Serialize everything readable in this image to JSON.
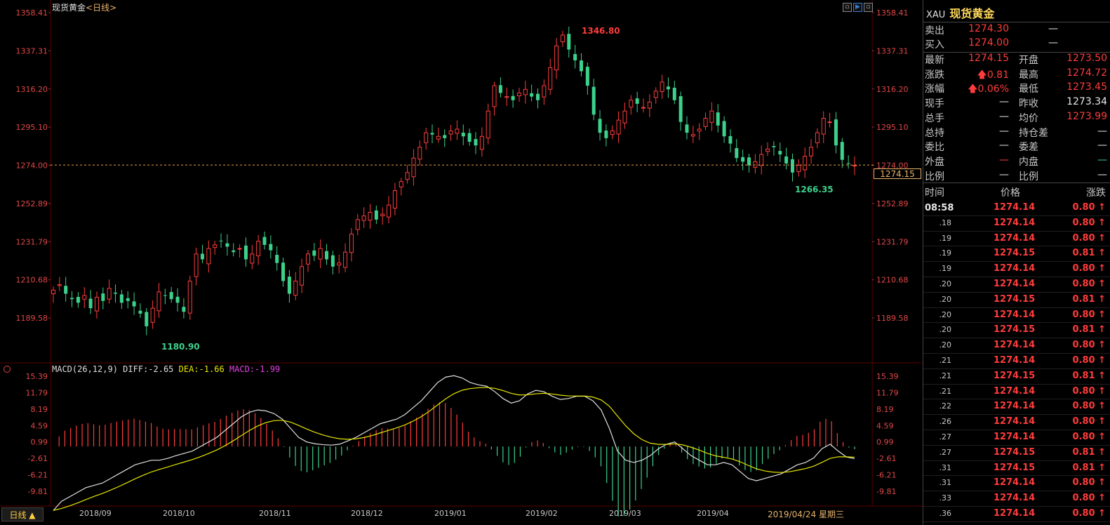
{
  "chart": {
    "title": "现货黄金",
    "period": "<日线>",
    "price_axis_ticks": [
      "1358.41",
      "1337.31",
      "1316.20",
      "1295.10",
      "1274.00",
      "1252.89",
      "1231.79",
      "1210.68",
      "1189.58"
    ],
    "price_range": [
      1180.0,
      1360.0
    ],
    "current_price_tag": "1274.15",
    "high_marker": "1346.80",
    "low_marker_recent": "1266.35",
    "low_marker": "1180.90",
    "macd_header": {
      "name": "MACD(26,12,9)",
      "diff": "DIFF:-2.65",
      "dea": "DEA:-1.66",
      "macd": "MACD:-1.99"
    },
    "macd_axis_ticks": [
      "15.39",
      "11.79",
      "8.19",
      "4.59",
      "0.99",
      "-2.61",
      "-6.21",
      "-9.81"
    ],
    "months": [
      "2018/09",
      "2018/10",
      "2018/11",
      "2018/12",
      "2019/01",
      "2019/02",
      "2019/03",
      "2019/04"
    ],
    "date_label": "2019/04/24 星期三",
    "period_button": "日线 ▲",
    "colors": {
      "up": "#ff3c3c",
      "down": "#3cd28c",
      "diff": "#e0e0e0",
      "dea": "#e6e600"
    }
  },
  "panel": {
    "code": "XAU",
    "name": "现货黄金",
    "sell": {
      "label": "卖出",
      "value": "1274.30",
      "right": "—"
    },
    "buy": {
      "label": "买入",
      "value": "1274.00",
      "right": "—"
    },
    "rows": [
      {
        "l1": "最新",
        "v1": "1274.15",
        "c1": "red",
        "l2": "开盘",
        "v2": "1273.50",
        "c2": "red"
      },
      {
        "l1": "涨跌",
        "v1": "🡅0.81",
        "c1": "red",
        "l2": "最高",
        "v2": "1274.72",
        "c2": "red"
      },
      {
        "l1": "涨幅",
        "v1": "🡅0.06%",
        "c1": "red",
        "l2": "最低",
        "v2": "1273.45",
        "c2": "red"
      },
      {
        "l1": "现手",
        "v1": "—",
        "c1": "white",
        "l2": "昨收",
        "v2": "1273.34",
        "c2": "white"
      },
      {
        "l1": "总手",
        "v1": "—",
        "c1": "white",
        "l2": "均价",
        "v2": "1273.99",
        "c2": "red"
      },
      {
        "l1": "总持",
        "v1": "—",
        "c1": "white",
        "l2": "持仓差",
        "v2": "—",
        "c2": "white"
      },
      {
        "l1": "委比",
        "v1": "—",
        "c1": "white",
        "l2": "委差",
        "v2": "—",
        "c2": "white"
      },
      {
        "l1": "外盘",
        "v1": "—",
        "c1": "red",
        "l2": "内盘",
        "v2": "—",
        "c2": "green"
      },
      {
        "l1": "比例",
        "v1": "—",
        "c1": "white",
        "l2": "比例",
        "v2": "—",
        "c2": "white"
      }
    ],
    "tick_header": {
      "time": "时间",
      "price": "价格",
      "change": "涨跌"
    },
    "ticks": [
      {
        "time": "08:58",
        "price": "1274.14",
        "change": "0.80"
      },
      {
        "time": ".18",
        "price": "1274.14",
        "change": "0.80"
      },
      {
        "time": ".19",
        "price": "1274.14",
        "change": "0.80"
      },
      {
        "time": ".19",
        "price": "1274.15",
        "change": "0.81"
      },
      {
        "time": ".19",
        "price": "1274.14",
        "change": "0.80"
      },
      {
        "time": ".20",
        "price": "1274.14",
        "change": "0.80"
      },
      {
        "time": ".20",
        "price": "1274.15",
        "change": "0.81"
      },
      {
        "time": ".20",
        "price": "1274.14",
        "change": "0.80"
      },
      {
        "time": ".20",
        "price": "1274.15",
        "change": "0.81"
      },
      {
        "time": ".20",
        "price": "1274.14",
        "change": "0.80"
      },
      {
        "time": ".21",
        "price": "1274.14",
        "change": "0.80"
      },
      {
        "time": ".21",
        "price": "1274.15",
        "change": "0.81"
      },
      {
        "time": ".21",
        "price": "1274.14",
        "change": "0.80"
      },
      {
        "time": ".22",
        "price": "1274.14",
        "change": "0.80"
      },
      {
        "time": ".26",
        "price": "1274.14",
        "change": "0.80"
      },
      {
        "time": ".27",
        "price": "1274.14",
        "change": "0.80"
      },
      {
        "time": ".27",
        "price": "1274.15",
        "change": "0.81"
      },
      {
        "time": ".31",
        "price": "1274.15",
        "change": "0.81"
      },
      {
        "time": ".31",
        "price": "1274.14",
        "change": "0.80"
      },
      {
        "time": ".33",
        "price": "1274.14",
        "change": "0.80"
      },
      {
        "time": ".36",
        "price": "1274.14",
        "change": "0.80"
      }
    ]
  },
  "chart_data": {
    "type": "candlestick",
    "close_trend": [
      1205,
      1208,
      1203,
      1200,
      1198,
      1202,
      1195,
      1201,
      1199,
      1206,
      1203,
      1198,
      1199,
      1196,
      1192,
      1185,
      1195,
      1204,
      1202,
      1200,
      1198,
      1193,
      1210,
      1225,
      1222,
      1228,
      1230,
      1232,
      1229,
      1226,
      1228,
      1222,
      1225,
      1232,
      1230,
      1227,
      1220,
      1210,
      1203,
      1210,
      1218,
      1225,
      1224,
      1228,
      1222,
      1218,
      1220,
      1226,
      1236,
      1244,
      1246,
      1248,
      1244,
      1247,
      1252,
      1260,
      1265,
      1270,
      1278,
      1284,
      1292,
      1291,
      1290,
      1289,
      1293,
      1294,
      1290,
      1287,
      1285,
      1290,
      1304,
      1318,
      1314,
      1312,
      1310,
      1314,
      1316,
      1312,
      1310,
      1318,
      1328,
      1340,
      1346,
      1338,
      1332,
      1326,
      1318,
      1302,
      1292,
      1289,
      1293,
      1299,
      1304,
      1310,
      1308,
      1306,
      1309,
      1315,
      1320,
      1316,
      1310,
      1298,
      1292,
      1291,
      1294,
      1300,
      1304,
      1296,
      1290,
      1286,
      1278,
      1276,
      1274,
      1276,
      1280,
      1283,
      1284,
      1280,
      1275,
      1270,
      1274,
      1279,
      1284,
      1292,
      1300,
      1298,
      1285,
      1277,
      1275,
      1274
    ],
    "macd_trend": [
      -14,
      -12,
      -11,
      -10,
      -9,
      -8.5,
      -8,
      -7,
      -6,
      -5,
      -4,
      -3.5,
      -3,
      -3,
      -2.6,
      -2,
      -1.5,
      -1,
      0,
      1,
      2,
      3.5,
      5,
      6.5,
      7.5,
      8,
      7.8,
      7.2,
      6,
      4,
      2,
      1,
      0.6,
      0.4,
      0.3,
      0.5,
      1.2,
      2,
      3,
      4,
      5,
      5.5,
      6,
      7,
      8.5,
      10,
      12,
      14,
      15.2,
      15.5,
      15,
      14,
      13.5,
      13.2,
      12,
      10.5,
      9.5,
      10,
      11.5,
      12.3,
      12,
      11,
      10.3,
      10.5,
      11,
      11,
      10,
      8,
      4,
      -1,
      -3,
      -3.5,
      -3,
      -2,
      -0.5,
      0.5,
      1,
      -0.5,
      -2,
      -3,
      -4,
      -4,
      -3.5,
      -4,
      -5.5,
      -7,
      -7.5,
      -7,
      -6.5,
      -6,
      -5,
      -4,
      -3.5,
      -2.5,
      -0.5,
      0.5,
      -1,
      -2.3,
      -2.65
    ]
  }
}
